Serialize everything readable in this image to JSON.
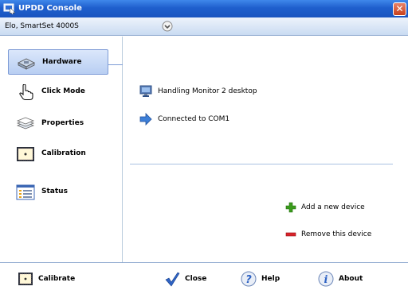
{
  "window": {
    "title": "UPDD Console",
    "close_glyph": "✕"
  },
  "device": {
    "name": "Elo, SmartSet 4000S"
  },
  "nav": {
    "items": [
      {
        "label": "Hardware",
        "icon": "hardware-icon"
      },
      {
        "label": "Click Mode",
        "icon": "hand-pointer-icon"
      },
      {
        "label": "Properties",
        "icon": "properties-icon"
      },
      {
        "label": "Calibration",
        "icon": "calibration-icon"
      },
      {
        "label": "Status",
        "icon": "status-icon"
      }
    ],
    "active_index": 0
  },
  "main": {
    "info": [
      {
        "text": "Handling Monitor 2 desktop",
        "icon": "monitor-icon"
      },
      {
        "text": "Connected to COM1",
        "icon": "arrow-right-icon"
      }
    ],
    "actions": [
      {
        "text": "Add a new device",
        "icon": "plus-icon"
      },
      {
        "text": "Remove this device",
        "icon": "minus-icon"
      }
    ]
  },
  "footer": {
    "calibrate": "Calibrate",
    "close": "Close",
    "help": "Help",
    "about": "About"
  },
  "colors": {
    "title_bar": "#1f5fcd",
    "accent_blue": "#7d9bd6",
    "add_green": "#3a9b1c",
    "remove_red": "#d8232a"
  }
}
